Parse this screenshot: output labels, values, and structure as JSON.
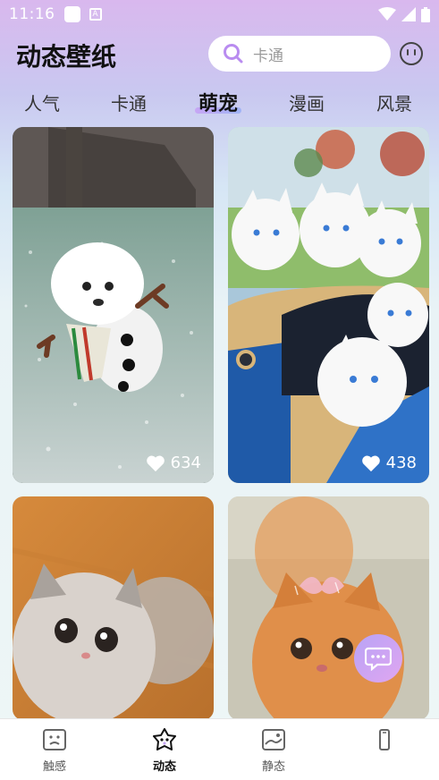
{
  "status_bar": {
    "time": "11:16",
    "notif_a": "A"
  },
  "header": {
    "title": "动态壁纸",
    "search_placeholder": "卡通"
  },
  "tabs": [
    {
      "label": "人气"
    },
    {
      "label": "卡通"
    },
    {
      "label": "萌宠"
    },
    {
      "label": "漫画"
    },
    {
      "label": "风景"
    }
  ],
  "active_tab": "萌宠",
  "cards": [
    {
      "likes": "634"
    },
    {
      "likes": "438"
    }
  ],
  "bottom_nav": [
    {
      "label": "触感",
      "icon": "image-frown-icon"
    },
    {
      "label": "动态",
      "icon": "star-face-icon"
    },
    {
      "label": "静态",
      "icon": "landscape-icon"
    },
    {
      "label": "",
      "icon": "phone-icon"
    }
  ],
  "colors": {
    "accent_purple": "#c7a6f5",
    "fab": "#b8a3f6"
  }
}
